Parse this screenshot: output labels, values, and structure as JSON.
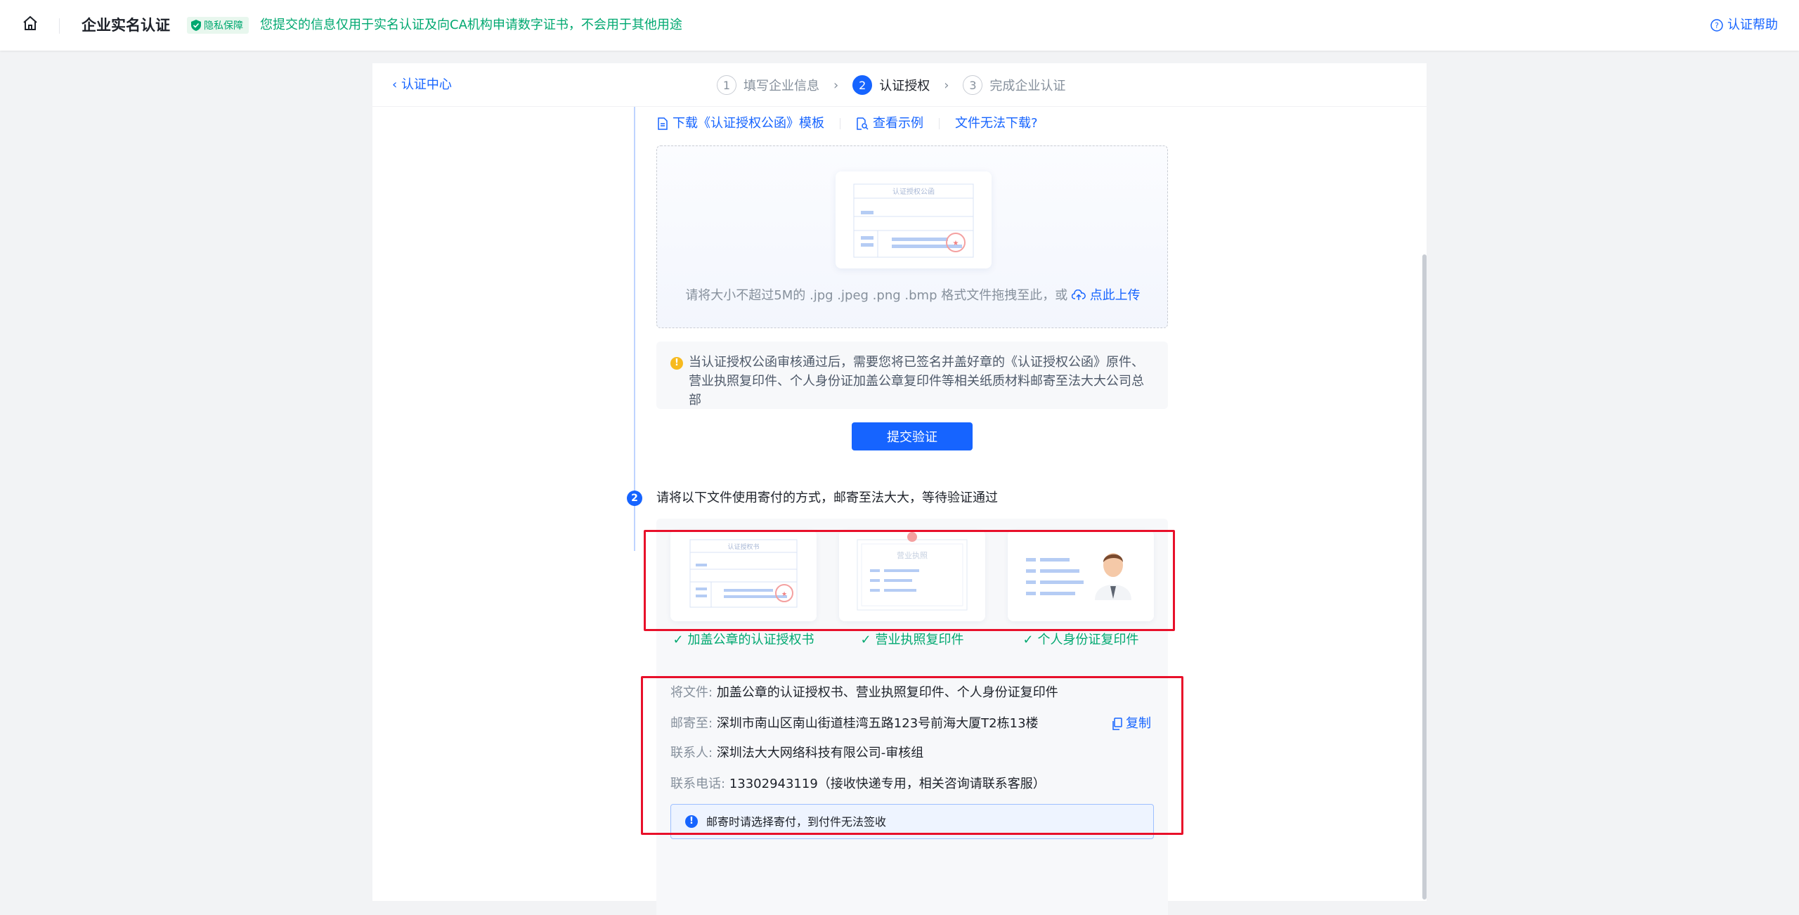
{
  "header": {
    "title": "企业实名认证",
    "privacy_badge": "隐私保障",
    "privacy_text": "您提交的信息仅用于实名认证及向CA机构申请数字证书，不会用于其他用途",
    "help": "认证帮助"
  },
  "nav": {
    "back": "认证中心",
    "steps": [
      {
        "num": "1",
        "label": "填写企业信息"
      },
      {
        "num": "2",
        "label": "认证授权"
      },
      {
        "num": "3",
        "label": "完成企业认证"
      }
    ]
  },
  "upload": {
    "download_link": "下载《认证授权公函》模板",
    "example_link": "查看示例",
    "cannot_download": "文件无法下载?",
    "doc_title": "认证授权公函",
    "hint": "请将大小不超过5M的 .jpg .jpeg .png .bmp 格式文件拖拽至此，或",
    "upload_link": "点此上传"
  },
  "warning": {
    "text": "当认证授权公函审核通过后，需要您将已签名并盖好章的《认证授权公函》原件、营业执照复印件、个人身份证加盖公章复印件等相关纸质材料邮寄至法大大公司总部"
  },
  "submit_label": "提交验证",
  "step2": {
    "num": "2",
    "title": "请将以下文件使用寄付的方式，邮寄至法大大，等待验证通过",
    "cards": [
      {
        "label": "加盖公章的认证授权书",
        "doc_title": "认证授权书"
      },
      {
        "label": "营业执照复印件",
        "doc_title": "营业执照"
      },
      {
        "label": "个人身份证复印件"
      }
    ],
    "info": {
      "files_key": "将文件:",
      "files_val": "加盖公章的认证授权书、营业执照复印件、个人身份证复印件",
      "address_key": "邮寄至:",
      "address_val": "深圳市南山区南山街道桂湾五路123号前海大厦T2栋13楼",
      "copy": "复制",
      "contact_key": "联系人:",
      "contact_val": "深圳法大大网络科技有限公司-审核组",
      "phone_key": "联系电话:",
      "phone_val": "13302943119（接收快递专用，相关咨询请联系客服）"
    },
    "notice": "邮寄时请选择寄付，到付件无法签收"
  },
  "colors": {
    "primary": "#1664ff",
    "success": "#00a870",
    "warning": "#f7ba1e",
    "highlight_border": "#e8102a"
  }
}
